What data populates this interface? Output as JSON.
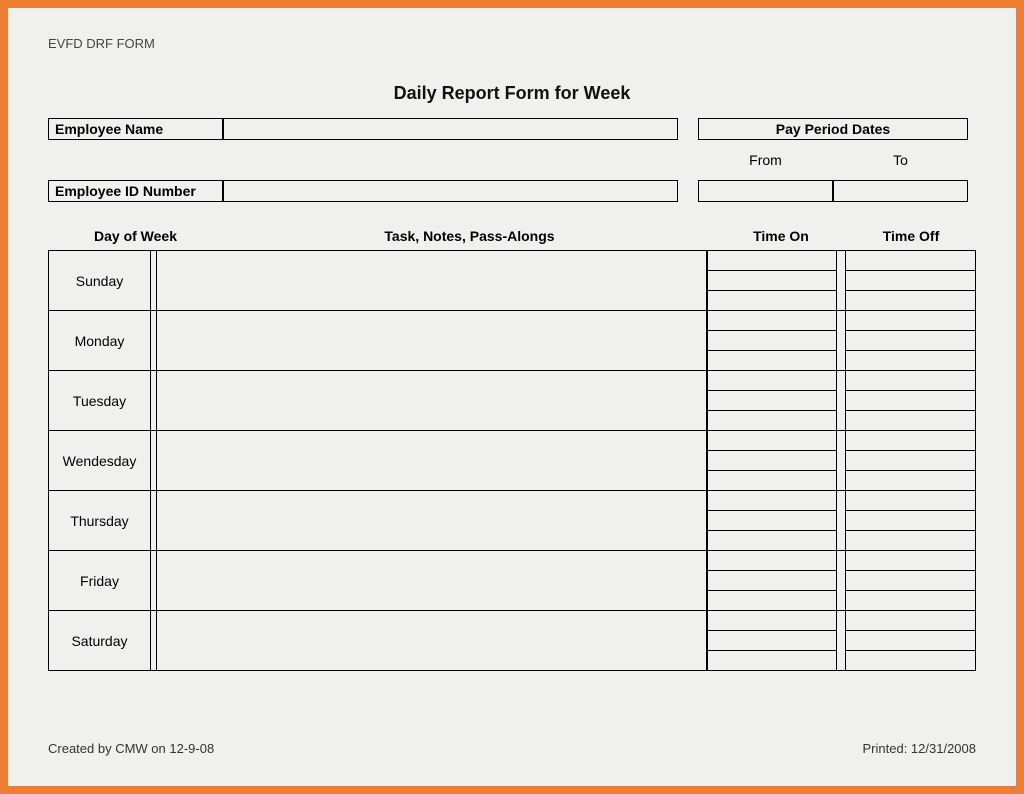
{
  "form_header": "EVFD DRF FORM",
  "title": "Daily Report Form for Week",
  "labels": {
    "employee_name": "Employee Name",
    "employee_id": "Employee ID Number",
    "pay_period": "Pay Period Dates",
    "from": "From",
    "to": "To"
  },
  "columns": {
    "day": "Day of Week",
    "tasks": "Task, Notes, Pass-Alongs",
    "time_on": "Time On",
    "time_off": "Time Off"
  },
  "days": [
    "Sunday",
    "Monday",
    "Tuesday",
    "Wendesday",
    "Thursday",
    "Friday",
    "Saturday"
  ],
  "footer": {
    "created": "Created by CMW on 12-9-08",
    "printed": "Printed: 12/31/2008"
  }
}
